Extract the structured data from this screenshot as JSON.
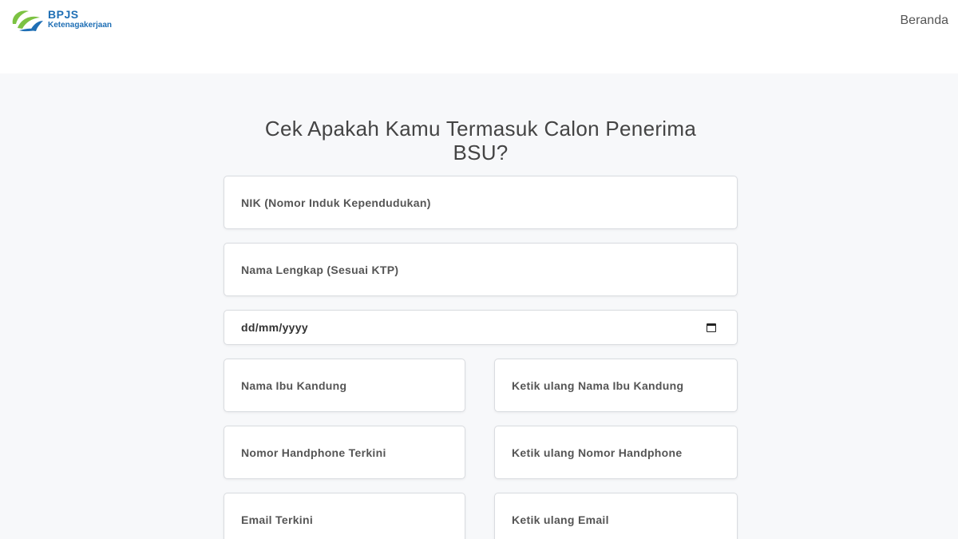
{
  "brand": {
    "name": "BPJS",
    "sub": "Ketenagakerjaan",
    "colors": {
      "blue": "#1f6fb5",
      "green": "#7cc242"
    }
  },
  "nav": {
    "home_label": "Beranda"
  },
  "form": {
    "title_line1": "Cek Apakah Kamu Termasuk Calon Penerima",
    "title_line2": "BSU?",
    "nik_placeholder": "NIK (Nomor Induk Kependudukan)",
    "name_placeholder": "Nama Lengkap (Sesuai KTP)",
    "dob_placeholder": "dd/mm/yyyy",
    "mother_placeholder": "Nama Ibu Kandung",
    "mother_confirm_placeholder": "Ketik ulang Nama Ibu Kandung",
    "phone_placeholder": "Nomor Handphone Terkini",
    "phone_confirm_placeholder": "Ketik ulang Nomor Handphone",
    "email_placeholder": "Email Terkini",
    "email_confirm_placeholder": "Ketik ulang Email"
  }
}
